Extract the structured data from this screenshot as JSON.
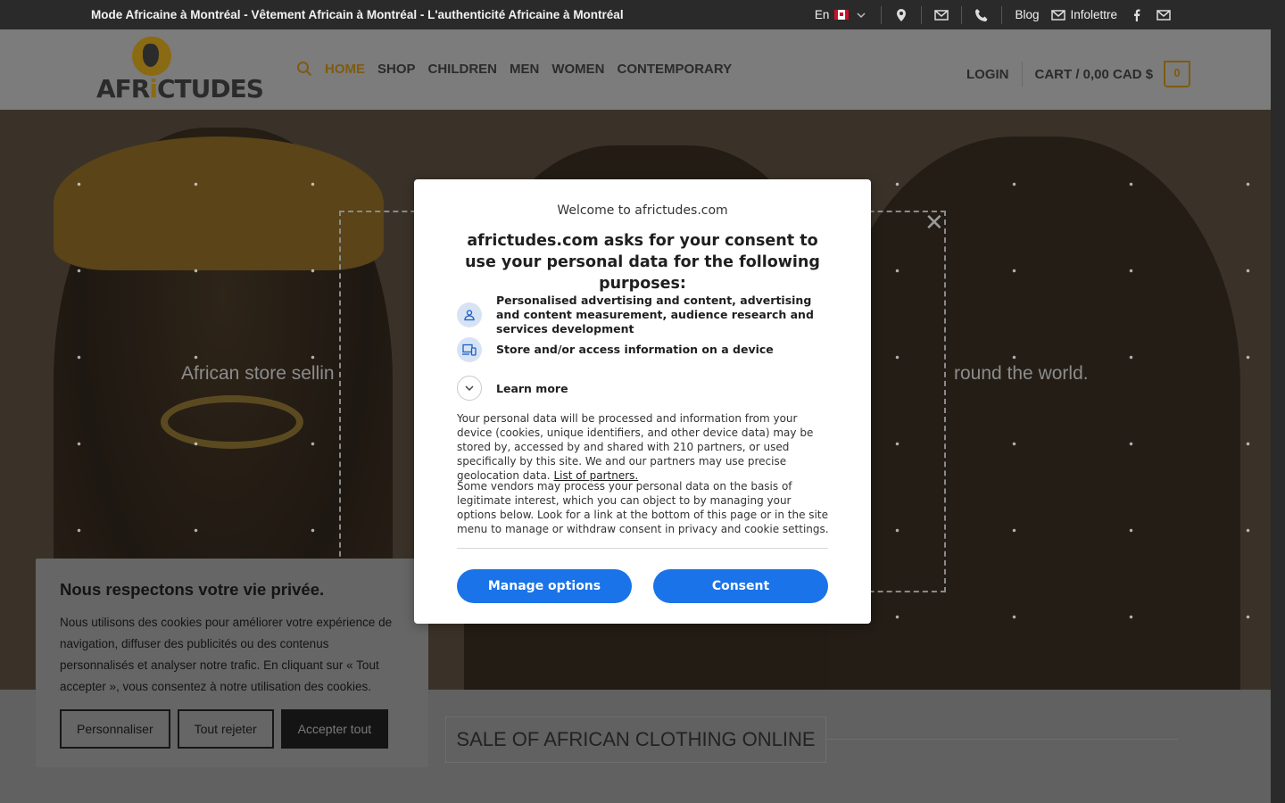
{
  "topbar": {
    "tagline": "Mode Africaine à Montréal - Vêtement Africain à Montréal - L'authenticité Africaine à Montréal",
    "lang": "En",
    "blog": "Blog",
    "newsletter": "Infolettre"
  },
  "header": {
    "logo_text_a": "AFR",
    "logo_text_i": "i",
    "logo_text_b": "CTUDES",
    "nav": [
      "HOME",
      "SHOP",
      "CHILDREN",
      "MEN",
      "WOMEN",
      "CONTEMPORARY"
    ],
    "login": "LOGIN",
    "cart": "CART / 0,00 CAD $",
    "cart_count": "0"
  },
  "hero": {
    "text_left": "African store sellin",
    "text_right": "round the world."
  },
  "section": {
    "title": "SALE OF AFRICAN CLOTHING ONLINE"
  },
  "privacy_banner": {
    "title": "Nous respectons votre vie privée.",
    "body": "Nous utilisons des cookies pour améliorer votre expérience de navigation, diffuser des publicités ou des contenus personnalisés et analyser notre trafic. En cliquant sur « Tout accepter », vous consentez à notre utilisation des cookies.",
    "customize": "Personnaliser",
    "reject_all": "Tout rejeter",
    "accept_all": "Accepter tout"
  },
  "consent_modal": {
    "welcome": "Welcome to africtudes.com",
    "headline": "africtudes.com asks for your consent to use your personal data for the following purposes:",
    "purpose_1": "Personalised advertising and content, advertising and content measurement, audience research and services development",
    "purpose_2": "Store and/or access information on a device",
    "learn_more": "Learn more",
    "paragraph_1": "Your personal data will be processed and information from your device (cookies, unique identifiers, and other device data) may be stored by, accessed by and shared with 210 partners, or used specifically by this site. We and our partners may use precise geolocation data.",
    "partners_link": "List of partners.",
    "paragraph_2": "Some vendors may process your personal data on the basis of legitimate interest, which you can object to by managing your options below. Look for a link at the bottom of this page or in the site menu to manage or withdraw consent in privacy and cookie settings.",
    "manage_options": "Manage options",
    "consent": "Consent"
  },
  "colors": {
    "accent_gold": "#7e5b12",
    "consent_blue": "#1a73e8",
    "icon_bg": "#d7e3f4"
  }
}
